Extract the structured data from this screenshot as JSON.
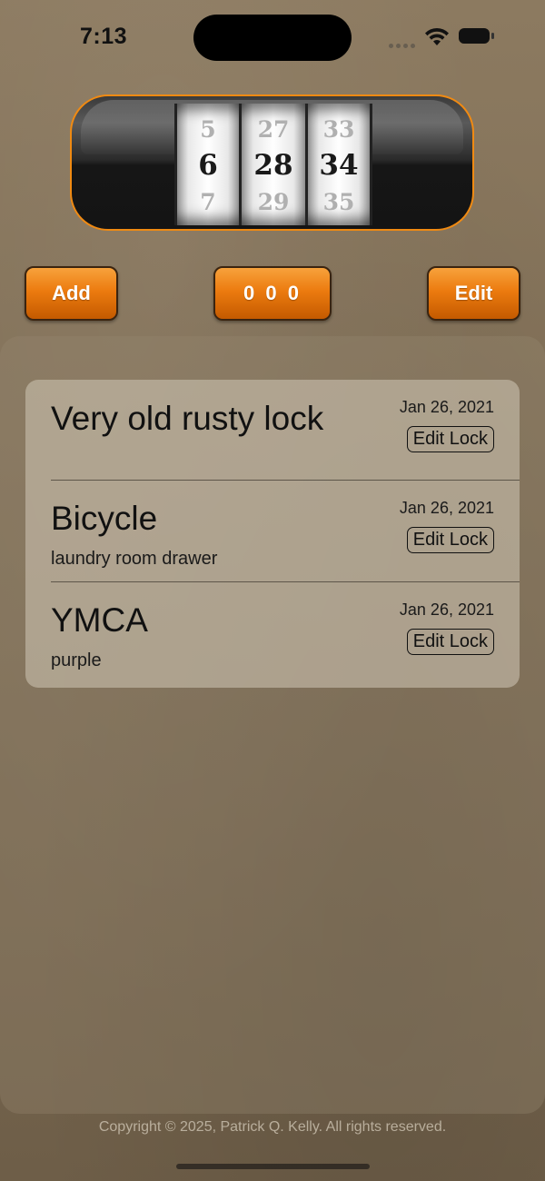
{
  "status_bar": {
    "time": "7:13",
    "icons": [
      "cellular-signal-icon",
      "wifi-icon",
      "battery-icon"
    ]
  },
  "dial": {
    "reels": [
      {
        "top": "5",
        "middle": "6",
        "bottom": "7"
      },
      {
        "top": "27",
        "middle": "28",
        "bottom": "29"
      },
      {
        "top": "33",
        "middle": "34",
        "bottom": "35"
      }
    ],
    "accent_color": "#f08a12"
  },
  "toolbar": {
    "add_label": "Add",
    "combo_label": "0 0 0",
    "edit_label": "Edit",
    "button_color": "#ec7b0f"
  },
  "locks": [
    {
      "name": "Very old rusty lock",
      "note": "",
      "date": "Jan 26, 2021",
      "edit_label": "Edit Lock"
    },
    {
      "name": "Bicycle",
      "note": "laundry room drawer",
      "date": "Jan 26, 2021",
      "edit_label": "Edit Lock"
    },
    {
      "name": "YMCA",
      "note": "purple",
      "date": "Jan 26, 2021",
      "edit_label": "Edit Lock"
    }
  ],
  "footer": {
    "copyright": "Copyright © 2025, Patrick Q. Kelly. All rights reserved."
  }
}
